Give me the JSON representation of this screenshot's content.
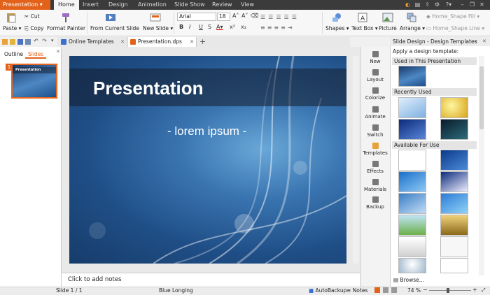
{
  "app": {
    "menu_label": "Presentation"
  },
  "menu": [
    "Home",
    "Insert",
    "Design",
    "Animation",
    "Slide Show",
    "Review",
    "View"
  ],
  "ribbon": {
    "paste": "Paste",
    "cut": "Cut",
    "copy": "Copy",
    "format_painter": "Format Painter",
    "from_current_slide": "From Current Slide",
    "new_slide": "New Slide",
    "font_name": "Arial",
    "font_size": "18",
    "shapes": "Shapes",
    "text_box": "Text Box",
    "picture": "Picture",
    "arrange": "Arrange",
    "shape_fill": "Home_Shape Fill",
    "shape_line": "Home_Shape Line"
  },
  "tabs": [
    "Online Templates",
    "Presentation.dps"
  ],
  "left_pane": {
    "tabs": [
      "Outline",
      "Slides"
    ],
    "slide_number": "1",
    "thumb_title": "Presentation"
  },
  "slide": {
    "title": "Presentation",
    "subtitle": "- lorem ipsum -"
  },
  "notes_placeholder": "Click to add notes",
  "side_tools": [
    "New",
    "Layout",
    "Colorize",
    "Animate",
    "Switch",
    "Templates",
    "Effects",
    "Materials",
    "Backup"
  ],
  "task_pane": {
    "title": "Slide Design - Design Templates",
    "apply_label": "Apply a design template:",
    "sections": [
      "Used in This Presentation",
      "Recently Used",
      "Available For Use"
    ],
    "browse": "Browse..."
  },
  "status": {
    "slide": "Slide 1 / 1",
    "theme": "Blue Longing",
    "autobackup": "AutoBackup",
    "notes": "Notes",
    "zoom": "74 %"
  },
  "colors": {
    "accent": "#e2621a",
    "menubar": "#3b3b3b"
  }
}
